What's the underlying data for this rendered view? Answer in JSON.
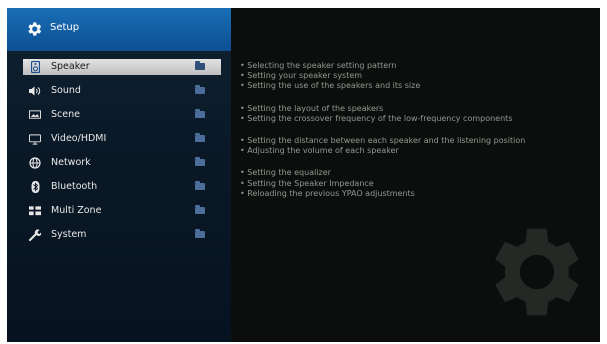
{
  "header": {
    "title": "Setup",
    "icon": "gear-icon",
    "color": "#1565b0"
  },
  "menu": {
    "items": [
      {
        "label": "Speaker",
        "icon": "speaker-icon",
        "selected": true
      },
      {
        "label": "Sound",
        "icon": "volume-icon",
        "selected": false
      },
      {
        "label": "Scene",
        "icon": "scene-icon",
        "selected": false
      },
      {
        "label": "Video/HDMI",
        "icon": "tv-icon",
        "selected": false
      },
      {
        "label": "Network",
        "icon": "globe-icon",
        "selected": false
      },
      {
        "label": "Bluetooth",
        "icon": "bluetooth-icon",
        "selected": false
      },
      {
        "label": "Multi Zone",
        "icon": "multi-zone-icon",
        "selected": false
      },
      {
        "label": "System",
        "icon": "wrench-icon",
        "selected": false
      }
    ]
  },
  "description": {
    "groups": [
      [
        "• Selecting the speaker setting pattern",
        "• Setting your speaker system",
        "• Setting the use of the speakers and its size"
      ],
      [
        "• Setting the layout of the speakers",
        "• Setting the crossover frequency of the low-frequency components"
      ],
      [
        "• Setting the distance between each speaker and the listening position",
        "• Adjusting the volume of each speaker"
      ],
      [
        "• Setting the equalizer",
        "• Setting the Speaker Impedance",
        "• Reloading the previous YPAO adjustments"
      ]
    ]
  },
  "colors": {
    "selected_bg": "#d6d6d6",
    "text": "#e8e8e8",
    "desc_text": "#8f9a8f",
    "folder": "#4a6d9a"
  }
}
